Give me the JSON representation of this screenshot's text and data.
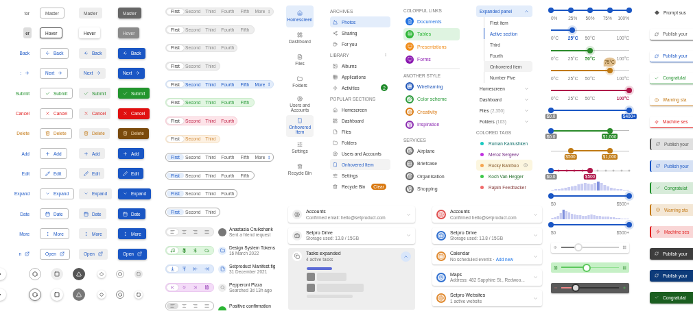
{
  "button_rows": [
    {
      "kind": "neutral",
      "buttons": [
        {
          "kind": "text",
          "label": "tor"
        },
        {
          "kind": "outlined",
          "label": "Master"
        },
        {
          "kind": "tonal",
          "label": "Master"
        },
        {
          "kind": "filled",
          "label": "Master"
        }
      ]
    },
    {
      "kind": "hover",
      "buttons": [
        {
          "kind": "text",
          "label": "er"
        },
        {
          "kind": "outlined",
          "label": "Hover"
        },
        {
          "kind": "tonal",
          "label": "Hover"
        },
        {
          "kind": "filled",
          "label": "Hover"
        }
      ]
    },
    {
      "kind": "primary",
      "buttons": [
        {
          "kind": "text",
          "label": "Back"
        },
        {
          "kind": "outlined",
          "label": "Back"
        },
        {
          "kind": "tonal",
          "label": "Back"
        },
        {
          "kind": "filled",
          "label": "Back"
        }
      ]
    },
    {
      "kind": "primary",
      "buttons": [
        {
          "kind": "text",
          "label": ":"
        },
        {
          "kind": "outlined",
          "label": "Next"
        },
        {
          "kind": "tonal",
          "label": "Next"
        },
        {
          "kind": "filled",
          "label": "Next"
        }
      ]
    },
    {
      "kind": "success",
      "buttons": [
        {
          "kind": "text",
          "label": "Submit"
        },
        {
          "kind": "outlined",
          "label": "Submit"
        },
        {
          "kind": "tonal",
          "label": "Submit"
        },
        {
          "kind": "filled",
          "label": "Submit"
        }
      ]
    },
    {
      "kind": "danger",
      "buttons": [
        {
          "kind": "text",
          "label": "Cancel"
        },
        {
          "kind": "outlined",
          "label": "Cancel"
        },
        {
          "kind": "tonal",
          "label": "Cancel"
        },
        {
          "kind": "filled",
          "label": "Cancel"
        }
      ]
    },
    {
      "kind": "warning",
      "buttons": [
        {
          "kind": "text",
          "label": "Delete"
        },
        {
          "kind": "outlined",
          "label": "Delete"
        },
        {
          "kind": "tonal",
          "label": "Delete"
        },
        {
          "kind": "filled",
          "label": "Delete"
        }
      ]
    },
    {
      "kind": "primary",
      "buttons": [
        {
          "kind": "text",
          "label": "Add"
        },
        {
          "kind": "outlined",
          "label": "Add"
        },
        {
          "kind": "tonal",
          "label": "Add"
        },
        {
          "kind": "filled",
          "label": "Add"
        }
      ]
    },
    {
      "kind": "primary",
      "buttons": [
        {
          "kind": "text",
          "label": "Edit"
        },
        {
          "kind": "outlined",
          "label": "Edit"
        },
        {
          "kind": "tonal",
          "label": "Edit"
        },
        {
          "kind": "filled",
          "label": "Edit"
        }
      ]
    },
    {
      "kind": "primary",
      "buttons": [
        {
          "kind": "text",
          "label": "Expand"
        },
        {
          "kind": "outlined",
          "label": "Expand"
        },
        {
          "kind": "tonal",
          "label": "Expand"
        },
        {
          "kind": "filled",
          "label": "Expand"
        }
      ]
    },
    {
      "kind": "primary",
      "buttons": [
        {
          "kind": "text",
          "label": "Date"
        },
        {
          "kind": "outlined",
          "label": "Date"
        },
        {
          "kind": "tonal",
          "label": "Date"
        },
        {
          "kind": "filled",
          "label": "Date"
        }
      ]
    },
    {
      "kind": "primary",
      "buttons": [
        {
          "kind": "text",
          "label": "More"
        },
        {
          "kind": "outlined",
          "label": "More"
        },
        {
          "kind": "tonal",
          "label": "More"
        },
        {
          "kind": "filled",
          "label": "More"
        }
      ]
    },
    {
      "kind": "primary",
      "buttons": [
        {
          "kind": "text",
          "label": "n"
        },
        {
          "kind": "outlined",
          "label": "Open"
        },
        {
          "kind": "tonal",
          "label": "Open"
        },
        {
          "kind": "filled",
          "label": "Open"
        }
      ]
    }
  ],
  "segments": [
    {
      "kind": "grey",
      "tabs": [
        {
          "label": "First",
          "selected": true
        },
        {
          "label": "Second",
          "selected": false
        },
        {
          "label": "Third",
          "selected": false
        },
        {
          "label": "Fourth",
          "selected": false
        },
        {
          "label": "Fifth",
          "selected": false
        }
      ],
      "more": "More"
    },
    {
      "kind": "grey",
      "tabs": [
        {
          "label": "First",
          "selected": true
        },
        {
          "label": "Second",
          "selected": false
        },
        {
          "label": "Third",
          "selected": false
        },
        {
          "label": "Fourth",
          "selected": false
        },
        {
          "label": "Fifth",
          "selected": false
        }
      ]
    },
    {
      "kind": "grey",
      "tabs": [
        {
          "label": "First",
          "selected": true
        },
        {
          "label": "Second",
          "selected": false
        },
        {
          "label": "Third",
          "selected": false
        },
        {
          "label": "Fourth",
          "selected": false
        }
      ]
    },
    {
      "kind": "grey",
      "tabs": [
        {
          "label": "First",
          "selected": true
        },
        {
          "label": "Second",
          "selected": false
        },
        {
          "label": "Third",
          "selected": false
        }
      ]
    },
    {
      "kind": "blue",
      "tabs": [
        {
          "label": "First",
          "selected": true
        },
        {
          "label": "Second",
          "selected": false
        },
        {
          "label": "Third",
          "selected": false
        },
        {
          "label": "Fourth",
          "selected": false
        },
        {
          "label": "Fifth",
          "selected": false
        }
      ],
      "more": "More"
    },
    {
      "kind": "green",
      "tabs": [
        {
          "label": "First",
          "selected": true
        },
        {
          "label": "Second",
          "selected": false
        },
        {
          "label": "Third",
          "selected": false
        },
        {
          "label": "Fourth",
          "selected": false
        },
        {
          "label": "Fifth",
          "selected": false
        }
      ]
    },
    {
      "kind": "red",
      "tabs": [
        {
          "label": "First",
          "selected": true
        },
        {
          "label": "Second",
          "selected": false
        },
        {
          "label": "Third",
          "selected": false
        },
        {
          "label": "Fourth",
          "selected": false
        }
      ]
    },
    {
      "kind": "orange",
      "tabs": [
        {
          "label": "First",
          "selected": true
        },
        {
          "label": "Second",
          "selected": false
        },
        {
          "label": "Third",
          "selected": false
        }
      ]
    },
    {
      "kind": "outline",
      "tabs": [
        {
          "label": "First",
          "selected": true
        },
        {
          "label": "Second",
          "selected": false
        },
        {
          "label": "Third",
          "selected": false
        },
        {
          "label": "Fourth",
          "selected": false
        },
        {
          "label": "Fifth",
          "selected": false
        }
      ],
      "more": "More"
    },
    {
      "kind": "outline",
      "tabs": [
        {
          "label": "First",
          "selected": true
        },
        {
          "label": "Second",
          "selected": false
        },
        {
          "label": "Third",
          "selected": false
        },
        {
          "label": "Fourth",
          "selected": false
        },
        {
          "label": "Fifth",
          "selected": false
        }
      ]
    },
    {
      "kind": "outline",
      "tabs": [
        {
          "label": "First",
          "selected": true
        },
        {
          "label": "Second",
          "selected": false
        },
        {
          "label": "Third",
          "selected": false
        },
        {
          "label": "Fourth",
          "selected": false
        }
      ]
    },
    {
      "kind": "outline",
      "tabs": [
        {
          "label": "First",
          "selected": true
        },
        {
          "label": "Second",
          "selected": false
        },
        {
          "label": "Third",
          "selected": false
        }
      ]
    }
  ],
  "toolbars": [
    {
      "kind": "grey",
      "tools": [
        {
          "selected": true
        },
        {
          "selected": false
        },
        {
          "selected": false
        },
        {
          "selected": false
        }
      ]
    },
    {
      "kind": "green",
      "tools": [
        {
          "selected": true
        },
        {
          "selected": false
        },
        {
          "selected": false
        },
        {
          "selected": false
        }
      ]
    },
    {
      "kind": "blue",
      "tools": [
        {
          "selected": true
        },
        {
          "selected": false
        },
        {
          "selected": false
        },
        {
          "selected": false
        }
      ]
    },
    {
      "kind": "purple",
      "tools": [
        {
          "selected": true
        },
        {
          "selected": false
        },
        {
          "selected": false
        },
        {
          "selected": false
        }
      ]
    },
    {
      "kind": "outline",
      "tools": [
        {
          "selected": true
        },
        {
          "selected": false
        },
        {
          "selected": false
        },
        {
          "selected": false
        }
      ]
    }
  ],
  "list_items": [
    {
      "title": "Anastasia Cruikshank",
      "subtitle": "Sent a friend request"
    },
    {
      "title": "Design System Tokens",
      "subtitle": "16 March 2022"
    },
    {
      "title": "Setproduct Manifest.fig",
      "subtitle": "31 December 2021"
    },
    {
      "title": "Pepperoni Pizza",
      "subtitle": "Searched 3d 13h ago"
    },
    {
      "title": "Positive confirmation"
    }
  ],
  "nav_rail": [
    {
      "label": "Homescreen",
      "selected": true,
      "hovered": false
    },
    {
      "label": "Dashboard",
      "selected": false,
      "hovered": false
    },
    {
      "label": "Files",
      "selected": false,
      "hovered": false
    },
    {
      "label": "Folders",
      "selected": false,
      "hovered": false
    },
    {
      "label": "Users and Accounts",
      "selected": false,
      "hovered": false
    },
    {
      "label": "Onhovered Item",
      "selected": false,
      "hovered": true
    },
    {
      "label": "Settings",
      "selected": false,
      "hovered": false
    },
    {
      "label": "Recycle Bin",
      "selected": false,
      "hovered": false
    }
  ],
  "nav_drawer": [
    {
      "header": "ARCHIVES",
      "items": [
        {
          "label": "Photos",
          "selected": true,
          "hovered": false
        },
        {
          "label": "Sharing",
          "selected": false,
          "hovered": false
        },
        {
          "label": "For you",
          "selected": false,
          "hovered": false
        }
      ]
    },
    {
      "header": "LIBRARY",
      "menu": true,
      "items": [
        {
          "label": "Albums",
          "selected": false,
          "hovered": false
        },
        {
          "label": "Applications",
          "selected": false,
          "hovered": false
        },
        {
          "label": "Activities",
          "selected": false,
          "hovered": false,
          "badge": "2"
        }
      ]
    },
    {
      "header": "POPULAR SECTIONS",
      "items": [
        {
          "label": "Homescreen",
          "selected": false,
          "hovered": false
        },
        {
          "label": "Dashboard",
          "selected": false,
          "hovered": false
        },
        {
          "label": "Files",
          "selected": false,
          "hovered": false
        },
        {
          "label": "Folders",
          "selected": false,
          "hovered": false
        },
        {
          "label": "Users and Accounts",
          "selected": false,
          "hovered": false
        },
        {
          "label": "Onhovered Item",
          "selected": false,
          "hovered": true
        },
        {
          "label": "Settings",
          "selected": false,
          "hovered": false
        },
        {
          "label": "Recycle Bin",
          "selected": false,
          "hovered": false,
          "badge": "Clear"
        }
      ]
    }
  ],
  "colored_lists": [
    {
      "header": "COLORFUL LINKS",
      "kind": "solid",
      "items": [
        {
          "label": "Documents",
          "selected": false,
          "color": "#1e6fe0"
        },
        {
          "label": "Tables",
          "selected": true,
          "color": "#2bb534"
        },
        {
          "label": "Presentations",
          "selected": false,
          "color": "#f08c1a"
        },
        {
          "label": "Forms",
          "selected": false,
          "color": "#8a17b0"
        }
      ]
    },
    {
      "header": "ANOTHER STYLE",
      "kind": "tinted",
      "items": [
        {
          "label": "Wireframing",
          "selected": false,
          "color": "#1e55b8"
        },
        {
          "label": "Color scheme",
          "selected": false,
          "color": "#2a9a3a"
        },
        {
          "label": "Creativity",
          "selected": false,
          "color": "#d9780f"
        },
        {
          "label": "Inspiration",
          "selected": false,
          "color": "#8a2ab0"
        }
      ]
    },
    {
      "header": "SERVICES",
      "kind": "grey",
      "items": [
        {
          "label": "Airplane",
          "selected": false,
          "color": "#666666"
        },
        {
          "label": "Briefcase",
          "selected": false,
          "color": "#666666"
        },
        {
          "label": "Organisation",
          "selected": false,
          "color": "#666666"
        },
        {
          "label": "Shopping",
          "selected": false,
          "color": "#666666"
        }
      ]
    }
  ],
  "accordion": [
    {
      "label": "Expanded panel",
      "expanded": true,
      "items": [
        {
          "label": "First item",
          "active": false,
          "hovered": false
        },
        {
          "label": "Active section",
          "active": true,
          "hovered": false
        },
        {
          "label": "Third",
          "active": false,
          "hovered": false
        },
        {
          "label": "Fourth",
          "active": false,
          "hovered": false
        },
        {
          "label": "Onhovered item",
          "active": false,
          "hovered": true
        },
        {
          "label": "Number Five",
          "active": false,
          "hovered": false
        }
      ]
    },
    {
      "label": "Homescreen",
      "expanded": false
    },
    {
      "label": "Dashboard",
      "expanded": false
    },
    {
      "label": "Files",
      "count": "(2,350)",
      "expanded": false
    },
    {
      "label": "Folders",
      "count": "(163)",
      "expanded": false
    }
  ],
  "tags": {
    "header": "COLORED TAGS",
    "items": [
      {
        "label": "Roman Kamushken",
        "color": "#19c9c0",
        "highlighted": false
      },
      {
        "label": "Meroz Sergeev",
        "color": "#c030e0",
        "highlighted": false
      },
      {
        "label": "Rocky Bamboo",
        "color": "#f5a550",
        "highlighted": true
      },
      {
        "label": "Koch Van Hegger",
        "color": "#3cc84a",
        "highlighted": false
      },
      {
        "label": "Rajain Feedbacker",
        "color": "#f06a6a",
        "highlighted": false
      }
    ]
  },
  "cards_left": [
    {
      "title": "Accounts",
      "subtitle": "Confirmed email: hello@setproduct.com",
      "expanded": false
    },
    {
      "title": "Setpro Drive",
      "subtitle": "Storage used: 13.8 / 15GB",
      "expanded": false
    },
    {
      "title": "Tasks expanded",
      "subtitle": "4 active tasks",
      "expanded": true
    }
  ],
  "cards_right": [
    {
      "title": "Accounts",
      "subtitle": "Confirmed hello@setproduct.com",
      "color": "#e05050"
    },
    {
      "title": "Setpro Drive",
      "subtitle": "Storage used: 13.8 / 15GB",
      "color": "#3070d0"
    },
    {
      "title": "Calendar",
      "subtitle": "No scheduled events ·",
      "link": "Add new",
      "color": "#e08a30"
    },
    {
      "title": "Maps",
      "subtitle": "Address: 482 Sapphire St., Redwoo...",
      "color": "#3070d0"
    },
    {
      "title": "Setpro Websites",
      "subtitle": "1 active website",
      "color": "#e08a30"
    }
  ],
  "sliders": [
    {
      "kind": "steps",
      "color": "#1a56c4",
      "level": 1,
      "labels": [
        {
          "text": "0%",
          "active": false
        },
        {
          "text": "25%",
          "active": false
        },
        {
          "text": "50%",
          "active": false
        },
        {
          "text": "75%",
          "active": false
        },
        {
          "text": "100%",
          "active": false
        }
      ]
    },
    {
      "kind": "single",
      "color": "#1a56c4",
      "level": 0.27,
      "labels": [
        {
          "text": "0°C",
          "active": false
        },
        {
          "text": "25°C",
          "active": true
        },
        {
          "text": "50°C",
          "active": false
        },
        {
          "text": "100°C",
          "active": false
        }
      ]
    },
    {
      "kind": "single",
      "color": "#2a8a2a",
      "level": 0.5,
      "labels": [
        {
          "text": "0°C",
          "active": false
        },
        {
          "text": "25°C",
          "active": false
        },
        {
          "text": "50°C",
          "active": true
        },
        {
          "text": "100°C",
          "active": false
        }
      ]
    },
    {
      "kind": "single",
      "color": "#c07a14",
      "level": 0.75,
      "tooltip": "75°C",
      "labels": [
        {
          "text": "0°C",
          "active": false
        },
        {
          "text": "25°C",
          "active": false
        },
        {
          "text": "50°C",
          "active": false
        },
        {
          "text": "100°C",
          "active": false
        }
      ]
    },
    {
      "kind": "single",
      "color": "#b0174a",
      "level": 1,
      "labels": [
        {
          "text": "0°C",
          "active": false
        },
        {
          "text": "25°C",
          "active": false
        },
        {
          "text": "50°C",
          "active": false
        },
        {
          "text": "100°C",
          "active": true
        }
      ]
    },
    {
      "kind": "range",
      "color": "#1a56c4",
      "thumbs": [
        {
          "level": 0,
          "color": "#1a56c4",
          "label": "$0.0",
          "highlighted": false
        },
        {
          "level": 1,
          "color": "#1a56c4",
          "label": "$400+",
          "highlighted": true
        }
      ]
    },
    {
      "kind": "range",
      "color": "#2a8a2a",
      "thumbs": [
        {
          "level": 0,
          "color": "#1a56c4",
          "label": "$0.0",
          "highlighted": false
        },
        {
          "level": 0.75,
          "color": "#2a8a2a",
          "label": "$1,000",
          "highlighted": true
        }
      ]
    },
    {
      "kind": "range",
      "color": "#c07a14",
      "thumbs": [
        {
          "level": 0.25,
          "color": "#c07a14",
          "label": "$500",
          "highlighted": true
        },
        {
          "level": 0.75,
          "color": "#c07a14",
          "label": "$1,000",
          "highlighted": true
        }
      ]
    },
    {
      "kind": "ticks",
      "color": "#b0174a",
      "thumbs": [
        {
          "level": 0,
          "color": "#1a56c4",
          "label": "$0.0",
          "highlighted": false
        },
        {
          "level": 0.5,
          "color": "#b0174a",
          "label": "$500",
          "highlighted": true
        }
      ]
    },
    {
      "kind": "histogram",
      "color": "#1a56c4",
      "thumbs": [
        {
          "level": 0,
          "color": "#1a56c4",
          "label": "$0"
        },
        {
          "level": 1,
          "color": "#1a56c4",
          "label": "$500+"
        }
      ]
    },
    {
      "kind": "histogram",
      "color": "#1a56c4",
      "thumbs": [
        {
          "level": 0,
          "color": "#1a56c4",
          "label": "$0"
        },
        {
          "level": 1,
          "color": "#1a56c4",
          "label": "$500+"
        }
      ]
    },
    {
      "kind": "card",
      "color": "#ffffff",
      "level": 0.3
    },
    {
      "kind": "card",
      "color": "#c6f0c6",
      "level": 0.44
    },
    {
      "kind": "card",
      "color": "#5a5a5a",
      "level": 0.25
    }
  ],
  "toasts": [
    {
      "kind": "plain",
      "color": "#555555",
      "text": "Prompt sus"
    },
    {
      "kind": "outlined",
      "color": "#555555",
      "text": "Publish your"
    },
    {
      "kind": "outlined",
      "color": "#1a56c4",
      "text": "Publish your"
    },
    {
      "kind": "outlined",
      "color": "#1f8f2a",
      "text": "Congratulat"
    },
    {
      "kind": "outlined",
      "color": "#c47a17",
      "text": "Warning sta"
    },
    {
      "kind": "outlined",
      "color": "#e01b1b",
      "text": "Machine ses"
    },
    {
      "kind": "tinted",
      "color": "#555555",
      "text": "Publish your"
    },
    {
      "kind": "tinted",
      "color": "#1a56c4",
      "text": "Publish your"
    },
    {
      "kind": "tinted",
      "color": "#1f8f2a",
      "text": "Congratulat"
    },
    {
      "kind": "tinted",
      "color": "#c47a17",
      "text": "Warning sta"
    },
    {
      "kind": "tinted",
      "color": "#e01b1b",
      "text": "Machine ses"
    },
    {
      "kind": "dark",
      "color": "#3d3d3d",
      "text": "Publish your"
    },
    {
      "kind": "dark",
      "color": "#0d3b7a",
      "text": "Publish your"
    },
    {
      "kind": "dark",
      "color": "#1b5e20",
      "text": "Congratulat"
    }
  ]
}
